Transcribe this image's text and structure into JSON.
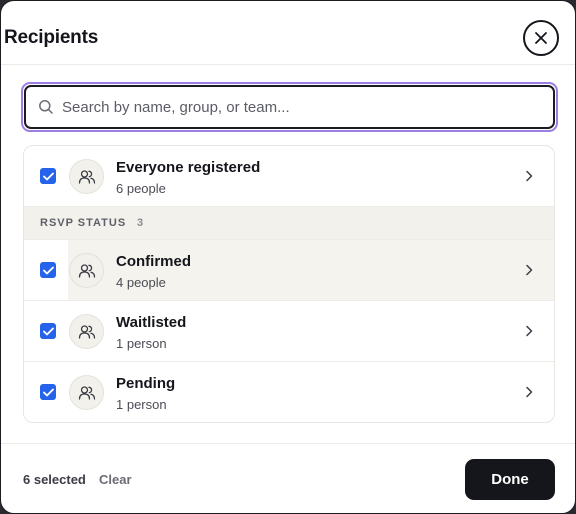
{
  "header": {
    "title": "Recipients",
    "close_icon": "close-icon"
  },
  "search": {
    "placeholder": "Search by name, group, or team...",
    "value": "",
    "icon": "search-icon"
  },
  "rows": [
    {
      "name": "Everyone registered",
      "count": "6 people",
      "checked": true,
      "icon": "people-icon"
    }
  ],
  "section": {
    "label": "RSVP STATUS",
    "count": "3",
    "items": [
      {
        "name": "Confirmed",
        "count": "4 people",
        "checked": true,
        "icon": "people-icon"
      },
      {
        "name": "Waitlisted",
        "count": "1 person",
        "checked": true,
        "icon": "people-icon"
      },
      {
        "name": "Pending",
        "count": "1 person",
        "checked": true,
        "icon": "people-icon"
      }
    ]
  },
  "footer": {
    "selected_label": "6 selected",
    "clear_label": "Clear",
    "done_label": "Done"
  },
  "colors": {
    "accent": "#2563eb",
    "focus_ring": "#9b7fe6",
    "primary_button": "#15161c"
  }
}
